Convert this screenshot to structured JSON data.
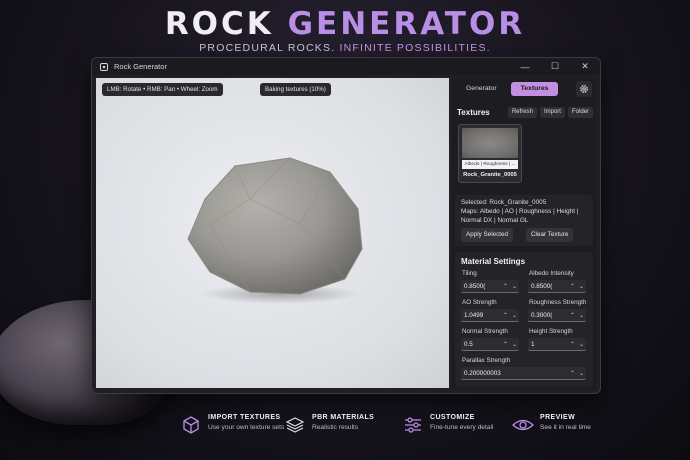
{
  "header": {
    "title_main": "ROCK",
    "title_accent": "GENERATOR",
    "subtitle_main": "PROCEDURAL ROCKS.",
    "subtitle_accent": "INFINITE POSSIBILITIES."
  },
  "window": {
    "title": "Rock Generator",
    "icons": {
      "app": "app-cube-icon",
      "minimize": "minimize-icon",
      "maximize": "maximize-icon",
      "close": "close-icon"
    },
    "viewport": {
      "controls_hint": "LMB: Rotate • RMB: Pan • Wheel: Zoom",
      "status": "Baking textures (10%)"
    },
    "panel": {
      "tabs": [
        "Generator",
        "Textures"
      ],
      "active_tab": "Textures",
      "settings_icon": "gear-icon",
      "textures": {
        "header": "Textures",
        "buttons": {
          "refresh": "Refresh",
          "import": "Import",
          "folder": "Folder"
        },
        "item": {
          "caption": "Albedo | Roughness | ...",
          "name": "Rock_Granite_0005"
        }
      },
      "selection": {
        "selected": "Selected: Rock_Granite_0005",
        "maps_line1": "Maps: Albedo | AO | Roughness | Height |",
        "maps_line2": "Normal DX | Normal GL",
        "apply_button": "Apply Selected",
        "clear_button": "Clear Texture"
      },
      "material": {
        "header": "Material Settings",
        "fields": {
          "tiling": {
            "label": "Tiling",
            "value": "0.8500("
          },
          "albedo_intensity": {
            "label": "Albedo Intensity",
            "value": "0.8500("
          },
          "ao_strength": {
            "label": "AO Strength",
            "value": "1.0499"
          },
          "roughness_strength": {
            "label": "Roughness Strength",
            "value": "0.3000("
          },
          "normal_strength": {
            "label": "Normal Strength",
            "value": "0.5"
          },
          "height_strength": {
            "label": "Height Strength",
            "value": "1"
          },
          "parallax_strength": {
            "label": "Parallax Strength",
            "value": "0.200000003"
          }
        }
      }
    }
  },
  "features": [
    {
      "title": "IMPORT TEXTURES",
      "subtitle": "Use your own texture sets",
      "icon": "cube-icon"
    },
    {
      "title": "PBR MATERIALS",
      "subtitle": "Realistic results",
      "icon": "layers-icon"
    },
    {
      "title": "CUSTOMIZE",
      "subtitle": "Fine-tune every detail",
      "icon": "sliders-icon"
    },
    {
      "title": "PREVIEW",
      "subtitle": "See it in real time",
      "icon": "eye-icon"
    }
  ],
  "colors": {
    "accent": "#c38fe0",
    "title_accent": "#b98ee6",
    "panel_bg": "#1d1d21",
    "viewport_bg": "#dcdee3"
  }
}
